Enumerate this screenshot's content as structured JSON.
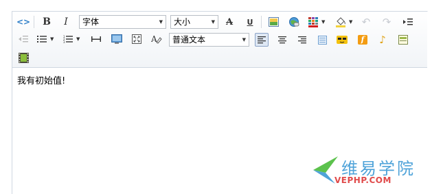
{
  "toolbar": {
    "font_family": "字体",
    "font_size": "大小",
    "paragraph_format": "普通文本",
    "bold_label": "B",
    "italic_label": "I",
    "strike_label": "A",
    "underline_label": "U",
    "flash_label": "f",
    "music_label": "♪",
    "undo_label": "↶",
    "redo_label": "↷",
    "source_label": "<>"
  },
  "content": {
    "text": "我有初始值!"
  },
  "watermark": {
    "text": "维易学院",
    "url": "VEPHP.COM"
  },
  "colors": {
    "accent": "#2f7fc8",
    "border": "#cfd7e1",
    "watermark_green": "#5cc24d",
    "watermark_blue": "#4fa3d9",
    "watermark_red": "#e04a4a"
  }
}
